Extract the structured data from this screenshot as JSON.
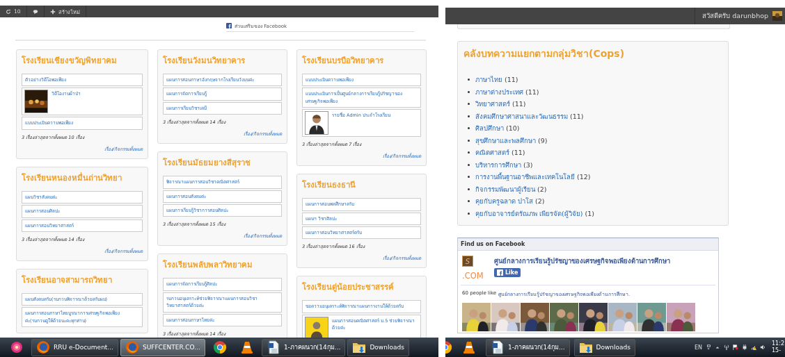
{
  "left_window": {
    "toolbar": {
      "updates": "10",
      "new_label": "สร้างใหม่"
    },
    "facebook_addon": "ส่วนเสริมของ Facebook",
    "columns": [
      [
        {
          "title": "โรงเรียนเชียงขวัญพิทยาคม",
          "items": [
            {
              "kind": "text",
              "text": "ตัวอย่างวิดีโอพอเพียง"
            },
            {
              "kind": "picture",
              "text": "วิดีโองานผ้าป่า"
            },
            {
              "kind": "text",
              "text": "แบบประเมินความพอเพียง"
            }
          ],
          "summary": "3 เรื่องล่าสุดจากทั้งหมด 10 เรื่อง",
          "more": "เรื่อง/กิจกรรมทั้งหมด"
        },
        {
          "title": "โรงเรียนหนองหมื่นถ่านวิทยา",
          "items": [
            {
              "kind": "text",
              "text": "แผนวิชาสังคมค่ะ"
            },
            {
              "kind": "text",
              "text": "แผนการสอนศิลปะ"
            },
            {
              "kind": "text",
              "text": "แผนการสอนวิทยาศาสตร์"
            }
          ],
          "summary": "3 เรื่องล่าสุดจากทั้งหมด 14 เรื่อง",
          "more": "เรื่อง/กิจกรรมทั้งหมด"
        },
        {
          "title": "โรงเรียนอาจสามารถวิทยา",
          "items": [
            {
              "kind": "text",
              "text": "แผนสังคมครับ(รบกวนพิจารณาด้วยครับผม)"
            },
            {
              "kind": "text",
              "text": "แผนการสอนภาษาไทยบูรณาการเศรษฐกิจพอเพียงค่ะ(รบกวนดูให้ด้วยนะคะทุกท่าน)"
            }
          ]
        }
      ],
      [
        {
          "title": "โรงเรียนวังมนวิทยาคาร",
          "items": [
            {
              "kind": "text",
              "text": "แผนการสอนภาษาอังกฤษจากโรงเรียนวังมนค่ะ"
            },
            {
              "kind": "text",
              "text": "แผนการจัดการเรียนรู้"
            },
            {
              "kind": "text",
              "text": "แผนการเรียนวิชาเคมี"
            }
          ],
          "summary": "3 เรื่องล่าสุดจากทั้งหมด 14 เรื่อง",
          "more": "เรื่อง/กิจกรรมทั้งหมด"
        },
        {
          "title": "โรงเรียนมัธยมยางสีสุราช",
          "items": [
            {
              "kind": "text",
              "text": "พิจารณาแผนการสอนวิชาคณิตศาสตร์"
            },
            {
              "kind": "text",
              "text": "แผนการสอนสังคมค่ะ"
            },
            {
              "kind": "text",
              "text": "แผนการเรียนรู้วิชาการสอนศิลปะ"
            }
          ],
          "summary": "3 เรื่องล่าสุดจากทั้งหมด 15 เรื่อง",
          "more": "เรื่อง/กิจกรรมทั้งหมด"
        },
        {
          "title": "โรงเรียนพลับพลาวิทยาคม",
          "items": [
            {
              "kind": "text",
              "text": "แผนการจัดการเรียนรู้ศิลปะ"
            },
            {
              "kind": "text",
              "text": "รบกวนอนุเคราะห์ช่วยพิจารณาแผนการสอนวิชาวิทยาศาสตร์ด้วยค่ะ"
            },
            {
              "kind": "text",
              "text": "แผนการสอนภาษาไทยค่ะ"
            }
          ],
          "summary": "3 เรื่องล่าสุดจากทั้งหมด 14 เรื่อง"
        }
      ],
      [
        {
          "title": "โรงเรียนบรบือวิทยาคาร",
          "items": [
            {
              "kind": "text",
              "text": "แบบประเมินความพอเพียง"
            },
            {
              "kind": "text",
              "text": "แบบประเมินการเป็นศูนย์กลางการเรียนรู้ปรัชญาของเศรษฐกิจพอเพียง"
            },
            {
              "kind": "person",
              "text": "รายชื่อ Admin ประจำโรงเรียน"
            }
          ],
          "summary": "3 เรื่องล่าสุดจากทั้งหมด 7 เรื่อง",
          "more": "เรื่อง/กิจกรรมทั้งหมด"
        },
        {
          "title": "โรงเรียนธงธานี",
          "items": [
            {
              "kind": "text",
              "text": "แผนการสอนพลศึกษาครับ"
            },
            {
              "kind": "text",
              "text": "แผนฯ วิชาศิลปะ"
            },
            {
              "kind": "text",
              "text": "แผนการสอนวิทยาศาสตร์ครับ"
            }
          ],
          "summary": "3 เรื่องล่าสุดจากทั้งหมด 16 เรื่อง",
          "more": "เรื่อง/กิจกรรมทั้งหมด"
        },
        {
          "title": "โรงเรียนดู่น้อยประชาสรรค์",
          "items": [
            {
              "kind": "text",
              "text": "ขอความอนุเคราะห์พิจารณาแผนการงานให้ด้วยครับ"
            },
            {
              "kind": "avatar",
              "text": "แผนการสอนคณิตศาสตร์ ม.5 ช่วยพิจารณาด้วยค่ะ"
            }
          ]
        }
      ]
    ],
    "taskbar": [
      {
        "kind": "flower"
      },
      {
        "kind": "firefox",
        "label": "RRU e-Document...",
        "selected": false
      },
      {
        "kind": "firefox",
        "label": "SUFFCENTER.CO...",
        "selected": true
      },
      {
        "kind": "chrome"
      },
      {
        "kind": "vlc"
      },
      {
        "kind": "word",
        "label": "1-ภาคผนวก(14กุม...",
        "selected": false
      },
      {
        "kind": "folder",
        "label": "Downloads",
        "selected": false
      }
    ]
  },
  "right_window": {
    "greeting": "สวัสดีครับ darunbhop",
    "archive": {
      "title": "คลังบทความแยกตามกลุ่มวิชา(Cops)",
      "items": [
        {
          "label": "ภาษาไทย",
          "count": "(11)"
        },
        {
          "label": "ภาษาต่างประเทศ",
          "count": "(11)"
        },
        {
          "label": "วิทยาศาสตร์",
          "count": "(11)"
        },
        {
          "label": "สังคมศึกษาศาสนาและวัฒนธรรม",
          "count": "(11)"
        },
        {
          "label": "ศิลปศึกษา",
          "count": "(10)"
        },
        {
          "label": "สุขศึกษาและพลศึกษา",
          "count": "(9)"
        },
        {
          "label": "คณิตศาสตร์",
          "count": "(11)"
        },
        {
          "label": "บริหารการศึกษา",
          "count": "(3)"
        },
        {
          "label": "การงานพื้นฐานอาชีพและเทคโนโลยี",
          "count": "(12)"
        },
        {
          "label": "กิจกรรมพัฒนาผู้เรียน",
          "count": "(2)"
        },
        {
          "label": "คุยกับครูฉลาด ปาโส",
          "count": "(2)"
        },
        {
          "label": "คุยกับอาจารย์ดรัณภพ เพียรจัด(ผู้วิจัย)",
          "count": "(1)"
        }
      ]
    },
    "facebook": {
      "header": "Find us on Facebook",
      "logo_mark": "S",
      "logo_text": ".COM",
      "page_name": "ศูนย์กลางการเรียนรู้ปรัชญาของเศรษฐกิจพอเพียงด้านการศึกษา",
      "like": "Like",
      "people_count": "60 people like",
      "people_page": "ศูนย์กลางการเรียนรู้ปรัชญาของเศรษฐกิจพอเพียงด้านการศึกษา."
    },
    "taskbar": [
      {
        "kind": "chrome"
      },
      {
        "kind": "vlc"
      },
      {
        "kind": "word",
        "label": "1-ภาคผนวก(14กุม...",
        "selected": false
      },
      {
        "kind": "folder",
        "label": "Downloads",
        "selected": false
      }
    ],
    "tray": {
      "language": "EN",
      "time": "11:2",
      "date": "15-"
    }
  }
}
